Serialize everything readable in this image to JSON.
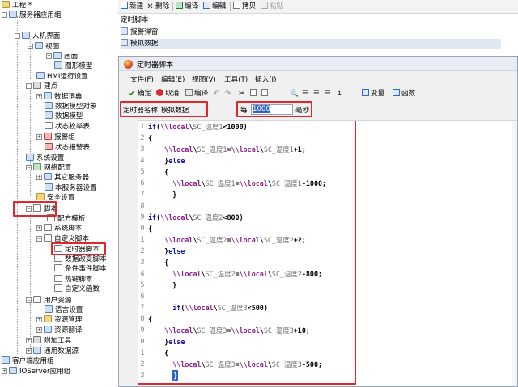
{
  "tree": {
    "items": [
      {
        "label": "工程 *"
      },
      {
        "label": "服务器应用组"
      },
      {
        "label": "人机界面"
      },
      {
        "label": "视图"
      },
      {
        "label": "画面"
      },
      {
        "label": "图形模型"
      },
      {
        "label": "HMI运行设置"
      },
      {
        "label": "建点"
      },
      {
        "label": "数据词典"
      },
      {
        "label": "数据模型对象"
      },
      {
        "label": "数据模型"
      },
      {
        "label": "状态枚举表"
      },
      {
        "label": "报警组"
      },
      {
        "label": "状态报警表"
      },
      {
        "label": "系统设置"
      },
      {
        "label": "网络配置"
      },
      {
        "label": "其它服务器"
      },
      {
        "label": "本服务器设置"
      },
      {
        "label": "安全设置"
      },
      {
        "label": "脚本"
      },
      {
        "label": "配方模板"
      },
      {
        "label": "系统脚本"
      },
      {
        "label": "自定义脚本"
      },
      {
        "label": "定时器脚本"
      },
      {
        "label": "数据改变脚本"
      },
      {
        "label": "条件事件脚本"
      },
      {
        "label": "热键脚本"
      },
      {
        "label": "自定义函数"
      },
      {
        "label": "用户资源"
      },
      {
        "label": "语言设置"
      },
      {
        "label": "资源管理"
      },
      {
        "label": "资源翻译"
      },
      {
        "label": "附加工具"
      },
      {
        "label": "通用数据源"
      },
      {
        "label": "客户端应用组"
      },
      {
        "label": "IOServer应用组"
      }
    ]
  },
  "toolbar": {
    "new_label": "新建",
    "delete_label": "删除",
    "compile_label": "编译",
    "edit_label": "编辑",
    "copy_label": "拷贝",
    "paste_label": "粘贴"
  },
  "list": {
    "header": "定时脚本",
    "items": [
      "报警弹窗",
      "模拟数据"
    ]
  },
  "dialog": {
    "title": "定时器脚本",
    "menu": [
      "文件(F)",
      "编辑(E)",
      "视图(V)",
      "工具(T)",
      "插入(I)"
    ],
    "toolbar": {
      "ok_label": "确定",
      "cancel_label": "取消",
      "compile_label": "编译",
      "variable_label": "变量",
      "function_label": "函数"
    },
    "name_label": "定时器名称:",
    "name_value": "模拟数据",
    "every_label": "每",
    "interval_value": "1000",
    "unit_label": "毫秒"
  },
  "code": {
    "line_numbers": [
      "1",
      "2",
      "3",
      "4",
      "5",
      "6",
      "7",
      "8",
      "9",
      "0",
      "1",
      "2",
      "3",
      "4",
      "5",
      "6",
      "7",
      "8",
      "9",
      "0",
      "1",
      "2",
      "3"
    ]
  }
}
